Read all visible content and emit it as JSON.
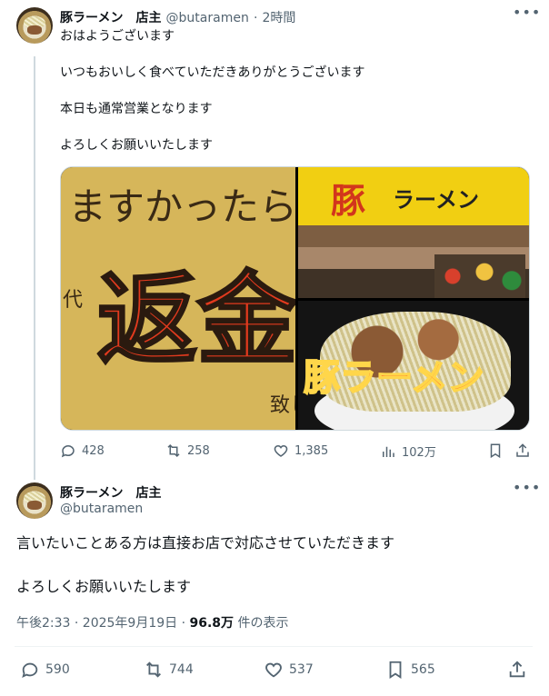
{
  "tweet1": {
    "author_name": "豚ラーメン　店主",
    "handle": "@butaramen",
    "separator": "·",
    "time": "2時間",
    "text": "おはようございます\n\nいつもおいしく食べていただきありがとうございます\n\n本日も通常営業となります\n\nよろしくお願いいたします",
    "media": {
      "sign_top": "ますかったら",
      "sign_big": "返金",
      "sign_small": "代",
      "sign_bottom": "致し",
      "awning_logo": "豚",
      "awning_text": "ラーメン",
      "ramen_text": "豚ラーメン"
    },
    "stats": {
      "replies": "428",
      "reposts": "258",
      "likes": "1,385",
      "views": "102万"
    }
  },
  "tweet2": {
    "author_name": "豚ラーメン　店主",
    "handle": "@butaramen",
    "text": "言いたいことある方は直接お店で対応させていただきます\n\nよろしくお願いいたします",
    "time_line": "午後2:33 · 2025年9月19日 · ",
    "view_count": "96.8万",
    "view_label": " 件の表示",
    "stats": {
      "replies": "590",
      "reposts": "744",
      "likes": "537",
      "bookmarks": "565"
    }
  },
  "colors": {
    "text": "#0f1419",
    "secondary": "#536471",
    "line": "#cfd9de"
  },
  "icons": [
    "more-icon",
    "reply-icon",
    "repost-icon",
    "like-icon",
    "views-icon",
    "bookmark-icon",
    "share-icon"
  ]
}
